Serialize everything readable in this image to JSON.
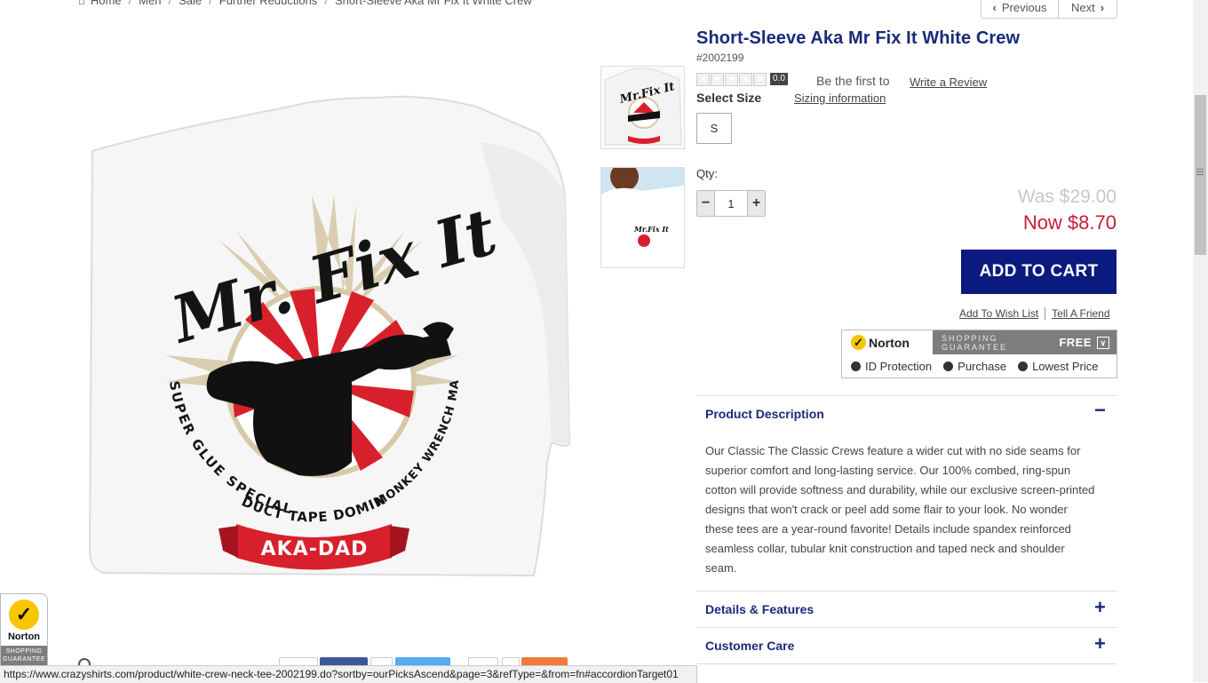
{
  "breadcrumb": [
    "Home",
    "Men",
    "Sale",
    "Further Reductions",
    "Short-Sleeve Aka Mr Fix It White Crew"
  ],
  "pager": {
    "previous": "Previous",
    "next": "Next"
  },
  "product": {
    "title": "Short-Sleeve Aka Mr Fix It White Crew",
    "sku": "#2002199",
    "rating": "0.0",
    "rating_stars": 0,
    "first_text": "Be the first to",
    "write_review": "Write a Review",
    "select_size": "Select Size",
    "sizing_info": "Sizing information",
    "sizes": [
      "S"
    ],
    "qty_label": "Qty:",
    "qty_value": "1",
    "was_price": "Was $29.00",
    "now_price": "Now $8.70",
    "add_to_cart": "ADD TO CART",
    "wishlist": "Add To Wish List",
    "tell_friend": "Tell A Friend"
  },
  "shirt_graphic": {
    "headline": "Mr. Fix It",
    "ring_left": "SUPER GLUE SPECIALIST",
    "ring_bottom": "DUCT TAPE DOMINATOR",
    "ring_right": "MONKEY WRENCH MASTER",
    "banner": "AKA-DAD"
  },
  "norton": {
    "brand": "Norton",
    "shopping": "SHOPPING",
    "guarantee": "GUARANTEE",
    "free": "FREE",
    "items": [
      "ID Protection",
      "Purchase",
      "Lowest Price"
    ]
  },
  "accordion": [
    {
      "title": "Product Description",
      "sign": "−"
    },
    {
      "title": "Details & Features",
      "sign": "+"
    },
    {
      "title": "Customer Care",
      "sign": "+"
    }
  ],
  "description": "Our Classic The Classic Crews feature a wider cut with no side seams for superior comfort and long-lasting service. Our 100% combed, ring-spun cotton will provide softness and durability, while our exclusive screen-printed designs that won't crack or peel add some flair to your look. No wonder these tees are a year-round favorite! Details include spandex reinforced seamless collar, tubular knit construction and taped neck and shoulder seam.",
  "badge": {
    "brand": "Norton",
    "line1": "SHOPPING",
    "line2": "GUARANTEE"
  },
  "status_url": "https://www.crazyshirts.com/product/white-crew-neck-tee-2002199.do?sortby=ourPicksAscend&page=3&refType=&from=fn#accordionTarget01",
  "colors": {
    "navy": "#0a1a7e",
    "title": "#1a2a7a",
    "sale": "#c41e3a"
  }
}
